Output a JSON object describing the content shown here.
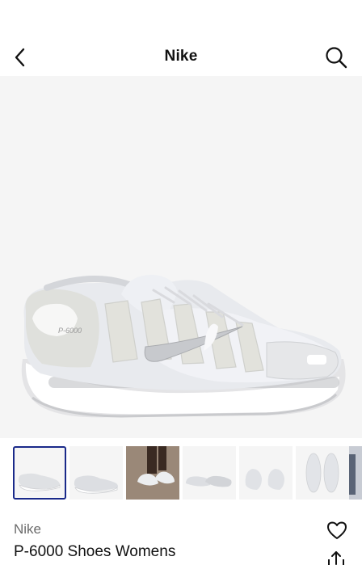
{
  "header": {
    "title": "Nike",
    "back_icon": "chevron-left-icon",
    "search_icon": "search-icon"
  },
  "hero": {
    "image": "white-silver-running-shoe-side-view",
    "logo_text": "P-6000"
  },
  "thumbnails": [
    {
      "name": "shoe-side-view",
      "selected": true
    },
    {
      "name": "shoe-angle-view",
      "selected": false
    },
    {
      "name": "shoe-on-feet",
      "selected": false
    },
    {
      "name": "shoe-pair-side",
      "selected": false
    },
    {
      "name": "shoe-heels",
      "selected": false
    },
    {
      "name": "shoe-top-view",
      "selected": false
    },
    {
      "name": "shoe-partial",
      "selected": false
    }
  ],
  "product": {
    "brand": "Nike",
    "name": "P-6000 Shoes Womens"
  },
  "actions": {
    "favorite_icon": "heart-icon",
    "share_icon": "share-icon"
  },
  "colors": {
    "image_bg": "#f5f5f5",
    "selected_border": "#1a2a8a",
    "brand_text": "#6b6b6b"
  }
}
